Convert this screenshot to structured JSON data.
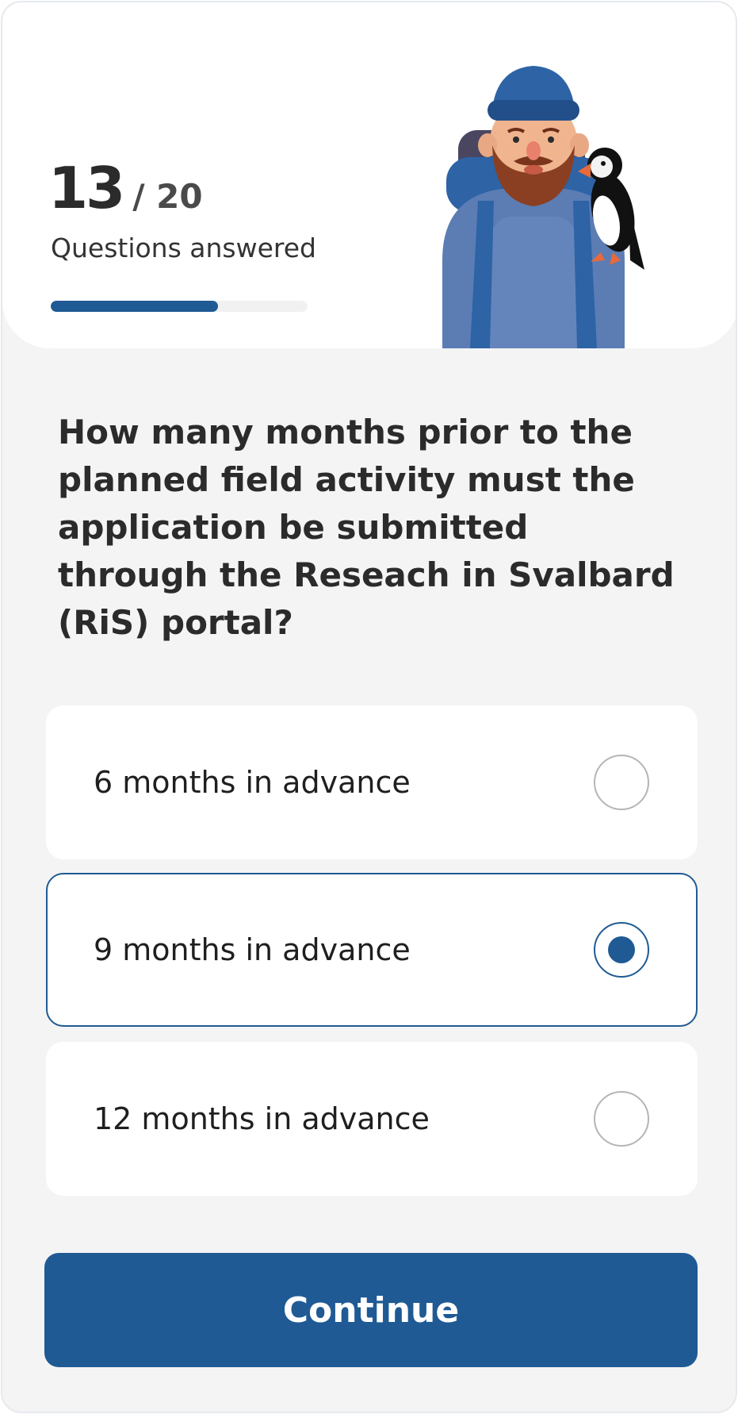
{
  "progress": {
    "answered": "13",
    "total": "/ 20",
    "label": "Questions answered",
    "fraction": 0.65
  },
  "illustration": {
    "icon": "hiker-with-puffin-illustration"
  },
  "question": {
    "text": "How many months prior to the planned field activity must the application be submitted through the Reseach in Svalbard (RiS) portal?"
  },
  "options": [
    {
      "label": "6 months in advance",
      "selected": false
    },
    {
      "label": "9 months in advance",
      "selected": true
    },
    {
      "label": "12 months in advance",
      "selected": false
    }
  ],
  "actions": {
    "continue_label": "Continue"
  },
  "colors": {
    "accent": "#1f5a94",
    "background": "#f4f4f4",
    "card": "#ffffff"
  }
}
